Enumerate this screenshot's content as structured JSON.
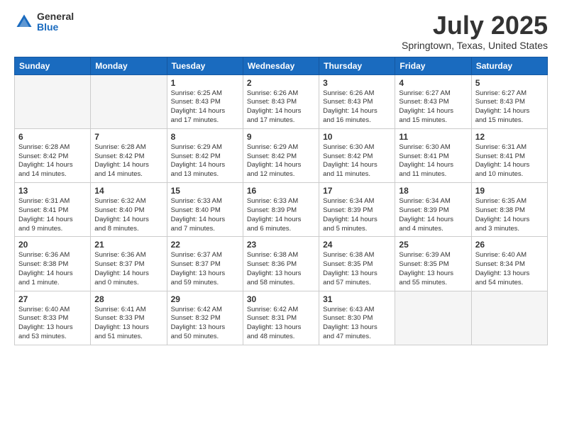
{
  "logo": {
    "general": "General",
    "blue": "Blue"
  },
  "title": {
    "month": "July 2025",
    "location": "Springtown, Texas, United States"
  },
  "days_of_week": [
    "Sunday",
    "Monday",
    "Tuesday",
    "Wednesday",
    "Thursday",
    "Friday",
    "Saturday"
  ],
  "weeks": [
    [
      {
        "day": "",
        "info": "",
        "empty": true
      },
      {
        "day": "",
        "info": "",
        "empty": true
      },
      {
        "day": "1",
        "info": "Sunrise: 6:25 AM\nSunset: 8:43 PM\nDaylight: 14 hours\nand 17 minutes."
      },
      {
        "day": "2",
        "info": "Sunrise: 6:26 AM\nSunset: 8:43 PM\nDaylight: 14 hours\nand 17 minutes."
      },
      {
        "day": "3",
        "info": "Sunrise: 6:26 AM\nSunset: 8:43 PM\nDaylight: 14 hours\nand 16 minutes."
      },
      {
        "day": "4",
        "info": "Sunrise: 6:27 AM\nSunset: 8:43 PM\nDaylight: 14 hours\nand 15 minutes."
      },
      {
        "day": "5",
        "info": "Sunrise: 6:27 AM\nSunset: 8:43 PM\nDaylight: 14 hours\nand 15 minutes."
      }
    ],
    [
      {
        "day": "6",
        "info": "Sunrise: 6:28 AM\nSunset: 8:42 PM\nDaylight: 14 hours\nand 14 minutes."
      },
      {
        "day": "7",
        "info": "Sunrise: 6:28 AM\nSunset: 8:42 PM\nDaylight: 14 hours\nand 14 minutes."
      },
      {
        "day": "8",
        "info": "Sunrise: 6:29 AM\nSunset: 8:42 PM\nDaylight: 14 hours\nand 13 minutes."
      },
      {
        "day": "9",
        "info": "Sunrise: 6:29 AM\nSunset: 8:42 PM\nDaylight: 14 hours\nand 12 minutes."
      },
      {
        "day": "10",
        "info": "Sunrise: 6:30 AM\nSunset: 8:42 PM\nDaylight: 14 hours\nand 11 minutes."
      },
      {
        "day": "11",
        "info": "Sunrise: 6:30 AM\nSunset: 8:41 PM\nDaylight: 14 hours\nand 11 minutes."
      },
      {
        "day": "12",
        "info": "Sunrise: 6:31 AM\nSunset: 8:41 PM\nDaylight: 14 hours\nand 10 minutes."
      }
    ],
    [
      {
        "day": "13",
        "info": "Sunrise: 6:31 AM\nSunset: 8:41 PM\nDaylight: 14 hours\nand 9 minutes."
      },
      {
        "day": "14",
        "info": "Sunrise: 6:32 AM\nSunset: 8:40 PM\nDaylight: 14 hours\nand 8 minutes."
      },
      {
        "day": "15",
        "info": "Sunrise: 6:33 AM\nSunset: 8:40 PM\nDaylight: 14 hours\nand 7 minutes."
      },
      {
        "day": "16",
        "info": "Sunrise: 6:33 AM\nSunset: 8:39 PM\nDaylight: 14 hours\nand 6 minutes."
      },
      {
        "day": "17",
        "info": "Sunrise: 6:34 AM\nSunset: 8:39 PM\nDaylight: 14 hours\nand 5 minutes."
      },
      {
        "day": "18",
        "info": "Sunrise: 6:34 AM\nSunset: 8:39 PM\nDaylight: 14 hours\nand 4 minutes."
      },
      {
        "day": "19",
        "info": "Sunrise: 6:35 AM\nSunset: 8:38 PM\nDaylight: 14 hours\nand 3 minutes."
      }
    ],
    [
      {
        "day": "20",
        "info": "Sunrise: 6:36 AM\nSunset: 8:38 PM\nDaylight: 14 hours\nand 1 minute."
      },
      {
        "day": "21",
        "info": "Sunrise: 6:36 AM\nSunset: 8:37 PM\nDaylight: 14 hours\nand 0 minutes."
      },
      {
        "day": "22",
        "info": "Sunrise: 6:37 AM\nSunset: 8:37 PM\nDaylight: 13 hours\nand 59 minutes."
      },
      {
        "day": "23",
        "info": "Sunrise: 6:38 AM\nSunset: 8:36 PM\nDaylight: 13 hours\nand 58 minutes."
      },
      {
        "day": "24",
        "info": "Sunrise: 6:38 AM\nSunset: 8:35 PM\nDaylight: 13 hours\nand 57 minutes."
      },
      {
        "day": "25",
        "info": "Sunrise: 6:39 AM\nSunset: 8:35 PM\nDaylight: 13 hours\nand 55 minutes."
      },
      {
        "day": "26",
        "info": "Sunrise: 6:40 AM\nSunset: 8:34 PM\nDaylight: 13 hours\nand 54 minutes."
      }
    ],
    [
      {
        "day": "27",
        "info": "Sunrise: 6:40 AM\nSunset: 8:33 PM\nDaylight: 13 hours\nand 53 minutes."
      },
      {
        "day": "28",
        "info": "Sunrise: 6:41 AM\nSunset: 8:33 PM\nDaylight: 13 hours\nand 51 minutes."
      },
      {
        "day": "29",
        "info": "Sunrise: 6:42 AM\nSunset: 8:32 PM\nDaylight: 13 hours\nand 50 minutes."
      },
      {
        "day": "30",
        "info": "Sunrise: 6:42 AM\nSunset: 8:31 PM\nDaylight: 13 hours\nand 48 minutes."
      },
      {
        "day": "31",
        "info": "Sunrise: 6:43 AM\nSunset: 8:30 PM\nDaylight: 13 hours\nand 47 minutes."
      },
      {
        "day": "",
        "info": "",
        "empty": true
      },
      {
        "day": "",
        "info": "",
        "empty": true
      }
    ]
  ]
}
